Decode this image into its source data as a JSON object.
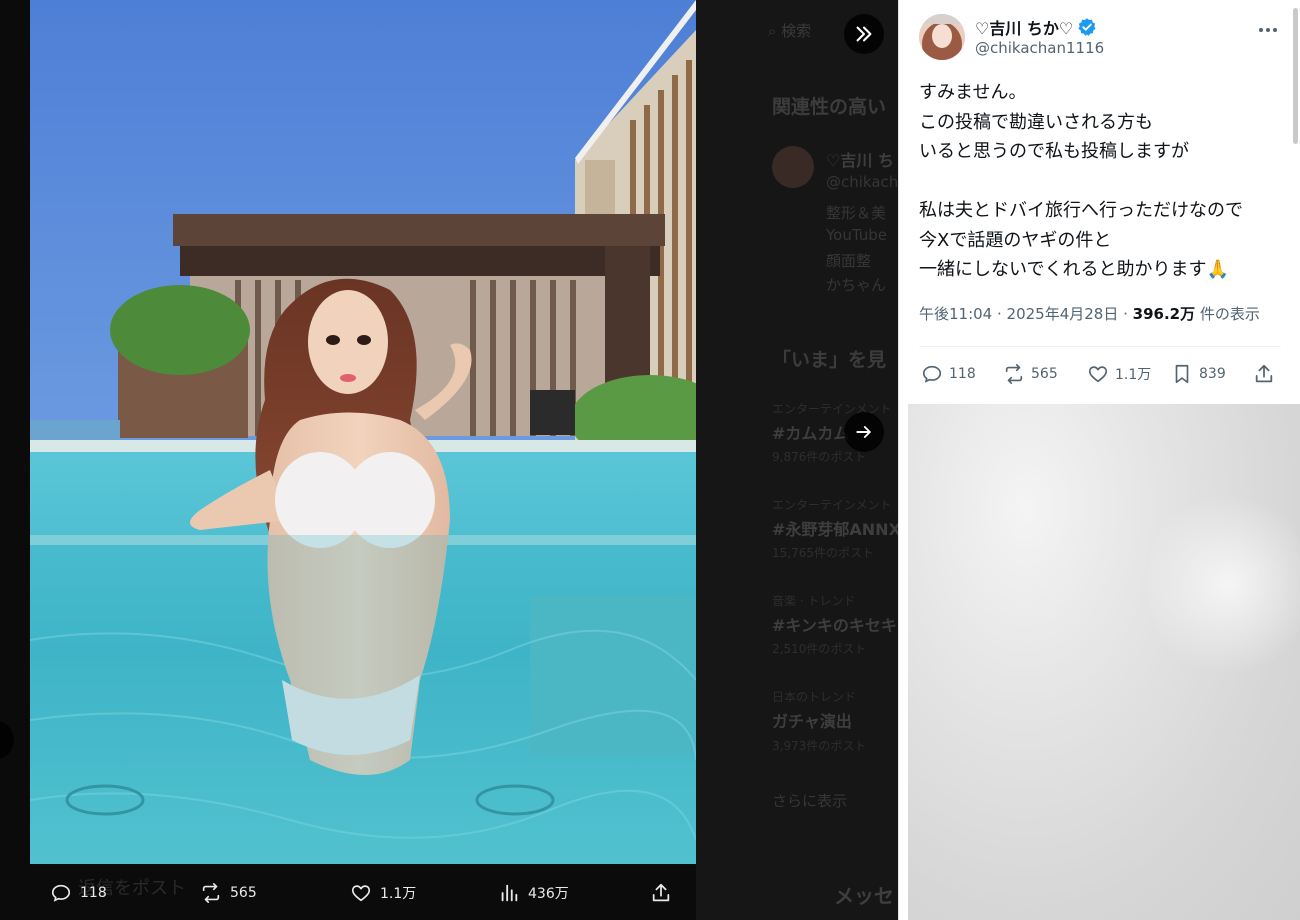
{
  "viewer": {
    "actions": {
      "replies": "118",
      "reposts": "565",
      "likes": "1.1万",
      "views": "436万"
    }
  },
  "background_page": {
    "search_placeholder": "検索",
    "section_related": "関連性の高い",
    "related_user_name": "♡吉川 ち",
    "related_user_handle": "@chikach",
    "related_bio_lines": [
      "整形＆美",
      "YouTube",
      "顔面整",
      "かちゃん"
    ],
    "section_now": "「いま」を見",
    "trends": [
      {
        "category": "エンターテインメント",
        "title": "#カムカム",
        "count": "9,876件のポスト"
      },
      {
        "category": "エンターテインメント",
        "title": "#永野芽郁ANNX",
        "count": "15,765件のポスト"
      },
      {
        "category": "音楽 · トレンド",
        "title": "#キンキのキセキ",
        "count": "2,510件のポスト"
      },
      {
        "category": "日本のトレンド",
        "title": "ガチャ演出",
        "count": "3,973件のポスト"
      }
    ],
    "show_more": "さらに表示",
    "reply_placeholder": "返信をポスト",
    "messages_label": "メッセ"
  },
  "post": {
    "display_name": "♡吉川 ちか♡",
    "handle": "@chikachan1116",
    "text_lines": [
      "すみません。",
      "この投稿で勘違いされる方も",
      "いると思うので私も投稿しますが",
      "",
      "私は夫とドバイ旅行へ行っただけなので",
      "今Xで話題のヤギの件と",
      "一緒にしないでくれると助かります🙏"
    ],
    "time": "午後11:04",
    "date": "2025年4月28日",
    "view_count": "396.2万",
    "view_suffix": "件の表示",
    "actions": {
      "replies": "118",
      "reposts": "565",
      "likes": "1.1万",
      "bookmarks": "839"
    }
  },
  "colors": {
    "accent": "#1d9bf0",
    "text_primary": "#0f1419",
    "text_secondary": "#536471"
  }
}
